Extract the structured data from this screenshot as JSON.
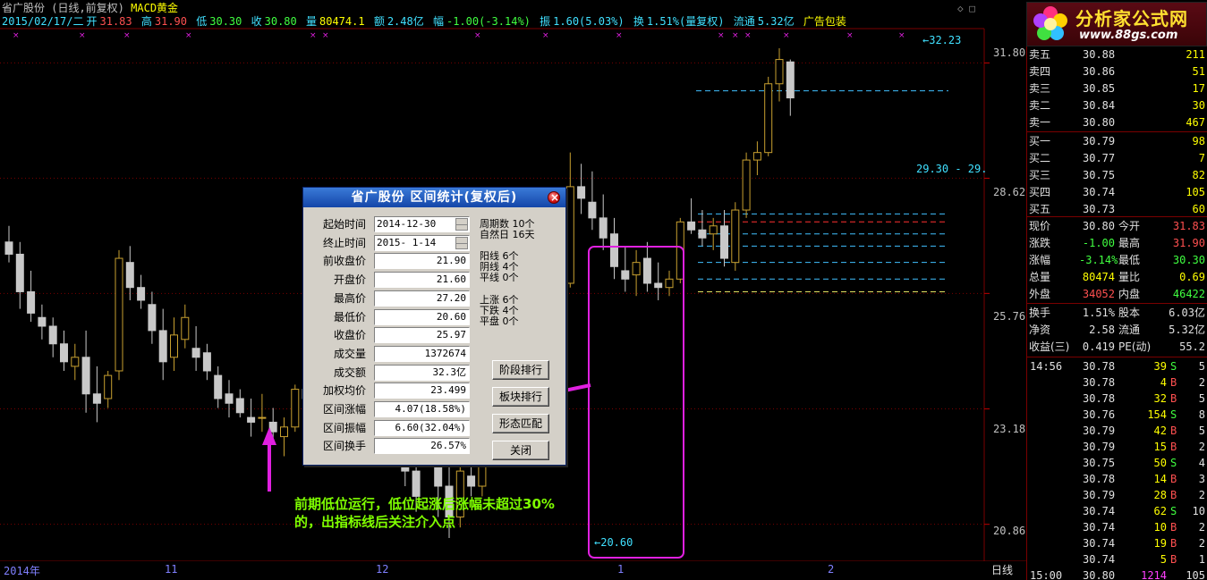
{
  "header": {
    "title_line": "省广股份 (日线,前复权)",
    "indicator": "MACD黄金",
    "date_weekday": "2015/02/17/二",
    "open_label": "开",
    "open": "31.83",
    "high_label": "高",
    "high": "31.90",
    "low_label": "低",
    "low": "30.30",
    "close_label": "收",
    "close": "30.80",
    "volume_label": "量",
    "volume": "80474.1",
    "amount_label": "额",
    "amount": "2.48亿",
    "change_label": "幅",
    "change": "-1.00(-3.14%)",
    "amplitude_label": "振",
    "amplitude": "1.60(5.03%)",
    "turnover_label": "换",
    "turnover": "1.51%(量复权)",
    "float_label": "流通",
    "float": "5.32亿",
    "ad_text": "广告包装"
  },
  "corner_icons": "◇ □",
  "logo": {
    "title": "分析家公式网",
    "url": "www.88gs.com"
  },
  "price_axis": [
    "31.80",
    "28.62",
    "25.76",
    "23.18",
    "20.86"
  ],
  "price_tags": {
    "high": "32.23",
    "low": "20.60",
    "level": "29.30 - 29."
  },
  "date_axis": [
    "2014年",
    "11",
    "12",
    "1",
    "2"
  ],
  "period": "日线",
  "order_book": [
    {
      "label": "卖五",
      "price": "30.88",
      "vol": "211"
    },
    {
      "label": "卖四",
      "price": "30.86",
      "vol": "51"
    },
    {
      "label": "卖三",
      "price": "30.85",
      "vol": "17"
    },
    {
      "label": "卖二",
      "price": "30.84",
      "vol": "30"
    },
    {
      "label": "卖一",
      "price": "30.80",
      "vol": "467"
    },
    {
      "label": "买一",
      "price": "30.79",
      "vol": "98"
    },
    {
      "label": "买二",
      "price": "30.77",
      "vol": "7"
    },
    {
      "label": "买三",
      "price": "30.75",
      "vol": "82"
    },
    {
      "label": "买四",
      "price": "30.74",
      "vol": "105"
    },
    {
      "label": "买五",
      "price": "30.73",
      "vol": "60"
    }
  ],
  "quote": [
    {
      "l1": "现价",
      "v1": "30.80",
      "l2": "今开",
      "v2": "31.83",
      "c1": "#e0e0e0",
      "c2": "#ff5050"
    },
    {
      "l1": "涨跌",
      "v1": "-1.00",
      "l2": "最高",
      "v2": "31.90",
      "c1": "#40ff40",
      "c2": "#ff5050"
    },
    {
      "l1": "涨幅",
      "v1": "-3.14%",
      "l2": "最低",
      "v2": "30.30",
      "c1": "#40ff40",
      "c2": "#40ff40"
    },
    {
      "l1": "总量",
      "v1": "80474",
      "l2": "量比",
      "v2": "0.69",
      "c1": "#ffff00",
      "c2": "#ffff00"
    },
    {
      "l1": "外盘",
      "v1": "34052",
      "l2": "内盘",
      "v2": "46422",
      "c1": "#ff5050",
      "c2": "#40ff40"
    }
  ],
  "finance": [
    {
      "l1": "换手",
      "v1": "1.51%",
      "l2": "股本",
      "v2": "6.03亿"
    },
    {
      "l1": "净资",
      "v1": "2.58",
      "l2": "流通",
      "v2": "5.32亿"
    },
    {
      "l1": "收益(三)",
      "v1": "0.419",
      "l2": "PE(动)",
      "v2": "55.2"
    }
  ],
  "ticks": [
    {
      "time": "14:56",
      "price": "30.78",
      "vol": "39",
      "bs": "S",
      "n": "5"
    },
    {
      "time": "",
      "price": "30.78",
      "vol": "4",
      "bs": "B",
      "n": "2"
    },
    {
      "time": "",
      "price": "30.78",
      "vol": "32",
      "bs": "B",
      "n": "5"
    },
    {
      "time": "",
      "price": "30.76",
      "vol": "154",
      "bs": "S",
      "n": "8"
    },
    {
      "time": "",
      "price": "30.79",
      "vol": "42",
      "bs": "B",
      "n": "5"
    },
    {
      "time": "",
      "price": "30.79",
      "vol": "15",
      "bs": "B",
      "n": "2"
    },
    {
      "time": "",
      "price": "30.75",
      "vol": "50",
      "bs": "S",
      "n": "4"
    },
    {
      "time": "",
      "price": "30.78",
      "vol": "14",
      "bs": "B",
      "n": "3"
    },
    {
      "time": "",
      "price": "30.79",
      "vol": "28",
      "bs": "B",
      "n": "2"
    },
    {
      "time": "",
      "price": "30.74",
      "vol": "62",
      "bs": "S",
      "n": "10"
    },
    {
      "time": "",
      "price": "30.74",
      "vol": "10",
      "bs": "B",
      "n": "2"
    },
    {
      "time": "",
      "price": "30.74",
      "vol": "19",
      "bs": "B",
      "n": "2"
    },
    {
      "time": "",
      "price": "30.74",
      "vol": "5",
      "bs": "B",
      "n": "1"
    },
    {
      "time": "15:00",
      "price": "30.80",
      "vol": "1214",
      "bs": "",
      "n": "105"
    }
  ],
  "dialog": {
    "title": "省广股份 区间统计(复权后)",
    "fields": [
      {
        "label": "起始时间",
        "value": "2014-12-30",
        "spin": true
      },
      {
        "label": "终止时间",
        "value": "2015- 1-14",
        "spin": true
      },
      {
        "label": "前收盘价",
        "value": "21.90"
      },
      {
        "label": "开盘价",
        "value": "21.60"
      },
      {
        "label": "最高价",
        "value": "27.20"
      },
      {
        "label": "最低价",
        "value": "20.60"
      },
      {
        "label": "收盘价",
        "value": "25.97"
      },
      {
        "label": "成交量",
        "value": "1372674"
      },
      {
        "label": "成交额",
        "value": "32.3亿"
      },
      {
        "label": "加权均价",
        "value": "23.499"
      },
      {
        "label": "区间涨幅",
        "value": "4.07(18.58%)"
      },
      {
        "label": "区间振幅",
        "value": "6.60(32.04%)"
      },
      {
        "label": "区间换手",
        "value": "26.57%"
      }
    ],
    "stats": [
      "周期数 10个",
      "自然日 16天",
      "阳线 6个",
      "阴线 4个",
      "平线 0个",
      "上涨 6个",
      "下跌 4个",
      "平盘 0个"
    ],
    "buttons": [
      "阶段排行",
      "板块排行",
      "形态匹配",
      "关闭"
    ]
  },
  "annotation": "前期低位运行，低位起涨后涨幅未超过30%的，出指标线后关注介入点",
  "chart_data": {
    "type": "candlestick",
    "note_series": "daily OHLC, front-adjusted",
    "ohlc": [
      [
        27.0,
        27.4,
        26.5,
        26.7
      ],
      [
        26.7,
        27.0,
        25.4,
        25.8
      ],
      [
        25.8,
        26.3,
        25.1,
        25.3
      ],
      [
        25.2,
        25.5,
        24.7,
        25.0
      ],
      [
        25.0,
        25.2,
        24.3,
        24.6
      ],
      [
        24.6,
        24.9,
        24.0,
        24.2
      ],
      [
        24.1,
        24.6,
        23.8,
        24.3
      ],
      [
        24.3,
        24.9,
        23.1,
        23.5
      ],
      [
        23.5,
        24.1,
        22.9,
        23.3
      ],
      [
        23.4,
        24.0,
        23.2,
        23.9
      ],
      [
        24.0,
        26.8,
        23.8,
        26.6
      ],
      [
        26.5,
        26.9,
        25.6,
        25.9
      ],
      [
        25.9,
        26.2,
        25.4,
        25.6
      ],
      [
        25.5,
        25.8,
        24.6,
        24.9
      ],
      [
        24.9,
        25.4,
        23.8,
        24.2
      ],
      [
        24.3,
        25.2,
        24.0,
        24.8
      ],
      [
        24.7,
        25.5,
        24.5,
        25.2
      ],
      [
        24.5,
        25.0,
        24.0,
        24.3
      ],
      [
        24.4,
        24.6,
        23.8,
        24.0
      ],
      [
        23.9,
        24.1,
        23.2,
        23.4
      ],
      [
        23.5,
        23.8,
        23.0,
        23.3
      ],
      [
        23.4,
        23.6,
        23.0,
        23.1
      ],
      [
        23.0,
        23.4,
        22.6,
        22.9
      ],
      [
        23.0,
        23.5,
        22.7,
        23.0
      ],
      [
        22.9,
        23.2,
        22.5,
        22.7
      ],
      [
        22.6,
        23.0,
        22.2,
        22.8
      ],
      [
        22.8,
        23.7,
        22.7,
        23.6
      ],
      [
        23.6,
        24.2,
        23.3,
        23.4
      ],
      [
        23.4,
        23.9,
        22.3,
        22.6
      ],
      [
        22.6,
        23.1,
        22.0,
        22.8
      ],
      [
        22.8,
        23.3,
        22.5,
        23.0
      ],
      [
        23.0,
        23.6,
        22.8,
        23.4
      ],
      [
        23.4,
        24.0,
        23.2,
        23.8
      ],
      [
        23.8,
        24.1,
        22.9,
        23.1
      ],
      [
        23.1,
        23.4,
        22.4,
        22.6
      ],
      [
        22.6,
        23.0,
        22.0,
        22.2
      ],
      [
        22.2,
        22.6,
        21.6,
        21.9
      ],
      [
        21.9,
        22.2,
        21.1,
        21.4
      ],
      [
        22.7,
        23.5,
        22.4,
        22.9
      ],
      [
        22.9,
        23.1,
        21.0,
        21.6
      ],
      [
        21.6,
        22.0,
        20.6,
        21.0
      ],
      [
        21.0,
        22.0,
        20.8,
        21.9
      ],
      [
        21.8,
        22.2,
        21.4,
        21.6
      ],
      [
        21.6,
        23.4,
        21.4,
        23.1
      ],
      [
        23.0,
        23.4,
        22.6,
        22.7
      ],
      [
        22.7,
        23.2,
        22.4,
        22.9
      ],
      [
        22.9,
        23.6,
        22.7,
        23.4
      ],
      [
        23.4,
        25.1,
        23.3,
        24.9
      ],
      [
        24.9,
        27.2,
        24.6,
        25.97
      ],
      [
        26.3,
        26.6,
        25.5,
        25.7
      ],
      [
        25.7,
        27.4,
        25.4,
        26.8
      ],
      [
        26.0,
        29.3,
        25.9,
        28.4
      ],
      [
        28.4,
        29.0,
        27.7,
        28.1
      ],
      [
        28.0,
        28.8,
        27.3,
        27.6
      ],
      [
        27.6,
        28.2,
        26.8,
        27.1
      ],
      [
        27.2,
        27.6,
        26.1,
        26.4
      ],
      [
        26.3,
        26.9,
        25.8,
        26.1
      ],
      [
        26.2,
        26.8,
        25.7,
        26.5
      ],
      [
        26.6,
        27.0,
        25.8,
        26.0
      ],
      [
        26.0,
        26.5,
        25.6,
        25.9
      ],
      [
        25.9,
        26.3,
        25.7,
        26.1
      ],
      [
        26.1,
        27.6,
        26.0,
        27.5
      ],
      [
        27.5,
        28.1,
        27.2,
        27.3
      ],
      [
        27.3,
        27.8,
        26.9,
        27.1
      ],
      [
        27.2,
        27.6,
        26.8,
        27.4
      ],
      [
        27.4,
        27.8,
        26.4,
        26.6
      ],
      [
        26.5,
        28.0,
        26.3,
        27.8
      ],
      [
        27.8,
        29.3,
        27.6,
        29.1
      ],
      [
        29.1,
        29.6,
        28.7,
        29.3
      ],
      [
        29.3,
        31.4,
        29.2,
        31.2
      ],
      [
        31.2,
        32.23,
        30.7,
        31.9
      ],
      [
        31.83,
        31.9,
        30.3,
        30.8
      ]
    ],
    "horizontal_levels": [
      {
        "price": 31.0,
        "color": "#40c0ff"
      },
      {
        "price": 27.7,
        "color": "#40c0ff"
      },
      {
        "price": 27.5,
        "color": "#ff3030"
      },
      {
        "price": 27.2,
        "color": "#40c0ff"
      },
      {
        "price": 26.9,
        "color": "#40c0ff"
      },
      {
        "price": 26.5,
        "color": "#40c0ff"
      },
      {
        "price": 26.1,
        "color": "#40c0ff"
      },
      {
        "price": 25.8,
        "color": "#e0e060"
      }
    ],
    "price_range": [
      20.3,
      32.6
    ]
  }
}
